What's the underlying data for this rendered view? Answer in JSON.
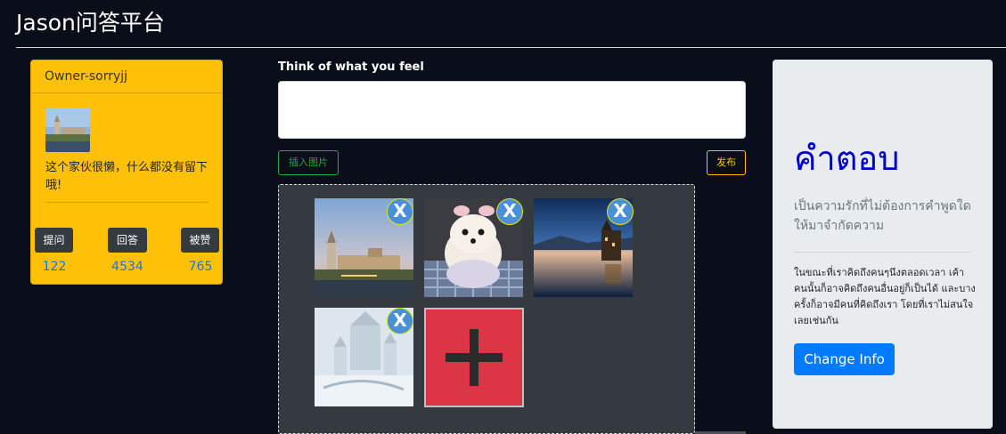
{
  "brand": "Jason问答平台",
  "profile": {
    "username": "Owner-sorryjj",
    "bio": "这个家伙很懒，什么都没有留下哦!",
    "stats": [
      {
        "label": "提问",
        "value": "122"
      },
      {
        "label": "回答",
        "value": "4534"
      },
      {
        "label": "被赞",
        "value": "765"
      }
    ]
  },
  "composer": {
    "label": "Think of what you feel",
    "textarea_value": "",
    "insert_image_label": "插入图片",
    "publish_label": "发布"
  },
  "uploads": {
    "remove_label": "X",
    "images": [
      {
        "name": "castle-town-photo"
      },
      {
        "name": "puppy-photo"
      },
      {
        "name": "lake-castle-photo"
      },
      {
        "name": "snow-castle-photo"
      }
    ],
    "add_icon": "plus-icon"
  },
  "answer": {
    "title": "คำตอบ",
    "lead": "เป็นความรักที่ไม่ต้องการคำพูดใดให้มาจำกัดความ",
    "body": "ในขณะที่เราคิดถึงคนๆนึงตลอดเวลา เค้าคนนั้นก็อาจคิดถึงคนอื่นอยู่ก็เป็นได้ และบางครั้งก็อาจมีคนที่คิดถึงเรา โดยที่เราไม่สนใจเลยเช่นกัน",
    "button_label": "Change Info"
  },
  "colors": {
    "background": "#0a0e1a",
    "profile_card": "#ffc107",
    "stat_number": "#1a73e8",
    "add_tile": "#dc3545",
    "answer_title": "#0000cc",
    "primary_button": "#007bff"
  }
}
